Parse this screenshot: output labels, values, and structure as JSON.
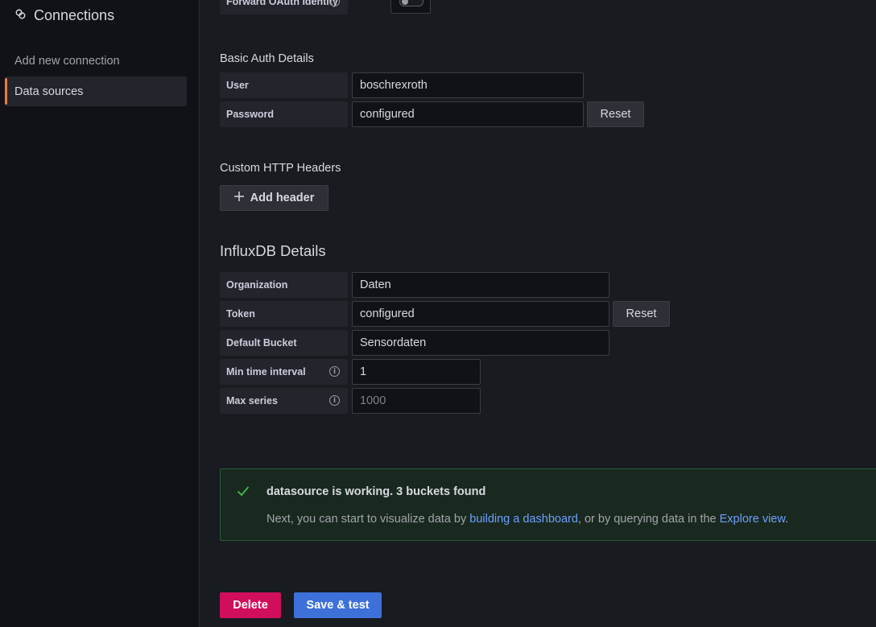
{
  "sidebar": {
    "title": "Connections",
    "items": [
      {
        "label": "Add new connection"
      },
      {
        "label": "Data sources"
      }
    ]
  },
  "oauth": {
    "label": "Forward OAuth Identity",
    "enabled": false
  },
  "basic_auth": {
    "title": "Basic Auth Details",
    "user_label": "User",
    "user_value": "boschrexroth",
    "password_label": "Password",
    "password_value": "configured",
    "reset_label": "Reset"
  },
  "headers": {
    "title": "Custom HTTP Headers",
    "add_label": "Add header"
  },
  "influx": {
    "title": "InfluxDB Details",
    "org_label": "Organization",
    "org_value": "Daten",
    "token_label": "Token",
    "token_value": "configured",
    "reset_label": "Reset",
    "bucket_label": "Default Bucket",
    "bucket_value": "Sensordaten",
    "min_interval_label": "Min time interval",
    "min_interval_value": "1",
    "max_series_label": "Max series",
    "max_series_placeholder": "1000"
  },
  "alert": {
    "title": "datasource is working. 3 buckets found",
    "text_1": "Next, you can start to visualize data by ",
    "link_1": "building a dashboard",
    "text_2": ", or by querying data in the ",
    "link_2": "Explore view",
    "text_3": "."
  },
  "actions": {
    "delete_label": "Delete",
    "save_label": "Save & test"
  },
  "colors": {
    "accent": "#f27a40",
    "delete": "#d10e5c",
    "primary": "#3d71d9",
    "success": "#3fb950",
    "link": "#6e9fff"
  }
}
